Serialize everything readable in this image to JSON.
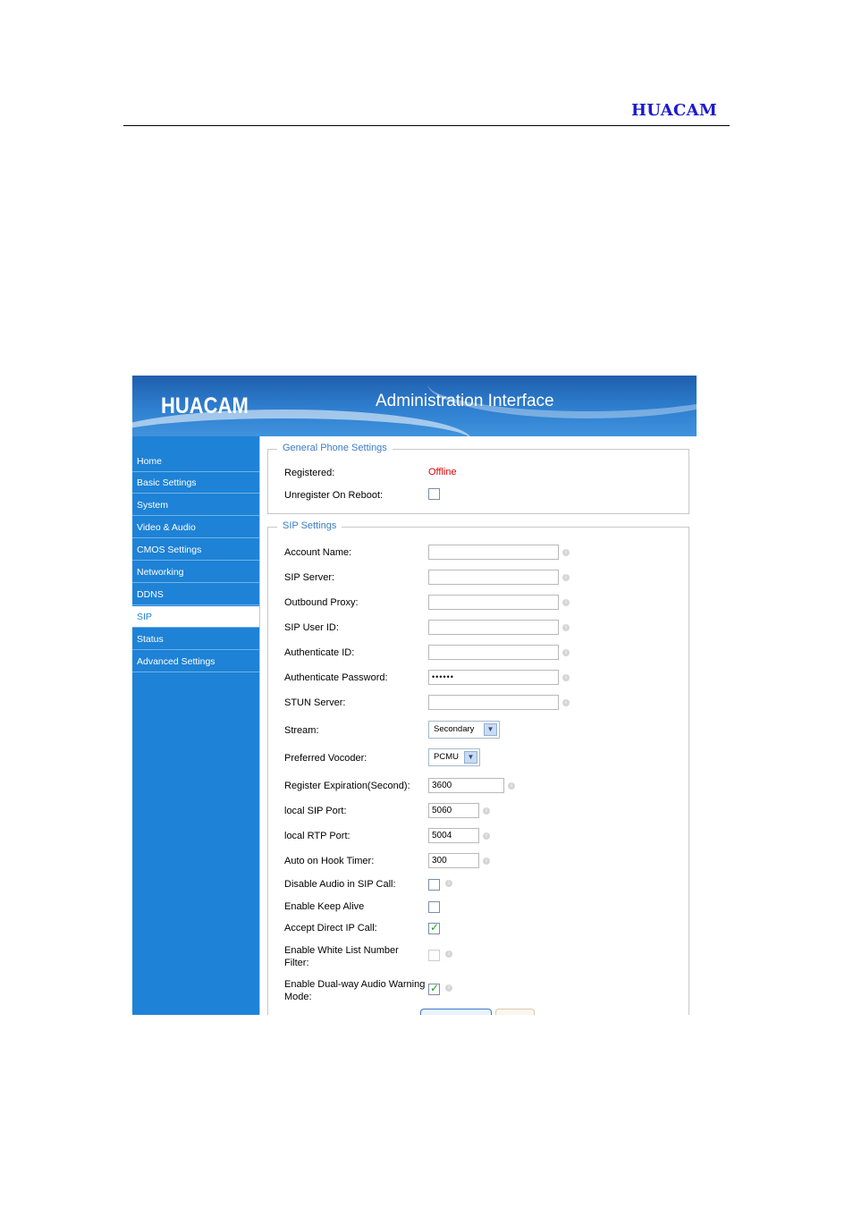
{
  "document": {
    "brand": "HUACAM"
  },
  "banner": {
    "logo": "HUACAM",
    "title": "Administration Interface"
  },
  "sidebar": {
    "items": [
      {
        "label": "Home"
      },
      {
        "label": "Basic Settings"
      },
      {
        "label": "System"
      },
      {
        "label": "Video & Audio"
      },
      {
        "label": "CMOS Settings"
      },
      {
        "label": "Networking"
      },
      {
        "label": "DDNS"
      },
      {
        "label": "SIP",
        "active": true
      },
      {
        "label": "Status"
      },
      {
        "label": "Advanced Settings"
      }
    ]
  },
  "general": {
    "legend": "General Phone Settings",
    "registered_label": "Registered:",
    "registered_value": "Offline",
    "unregister_label": "Unregister On Reboot:",
    "unregister_checked": false
  },
  "sip": {
    "legend": "SIP Settings",
    "account_name_label": "Account Name:",
    "account_name_value": "",
    "sip_server_label": "SIP Server:",
    "sip_server_value": "",
    "outbound_proxy_label": "Outbound Proxy:",
    "outbound_proxy_value": "",
    "sip_user_id_label": "SIP User ID:",
    "sip_user_id_value": "",
    "auth_id_label": "Authenticate ID:",
    "auth_id_value": "",
    "auth_password_label": "Authenticate Password:",
    "auth_password_value": "••••••",
    "stun_label": "STUN Server:",
    "stun_value": "",
    "stream_label": "Stream:",
    "stream_value": "Secondary",
    "vocoder_label": "Preferred Vocoder:",
    "vocoder_value": "PCMU",
    "reg_exp_label": "Register Expiration(Second):",
    "reg_exp_value": "3600",
    "local_sip_port_label": "local SIP Port:",
    "local_sip_port_value": "5060",
    "local_rtp_port_label": "local RTP Port:",
    "local_rtp_port_value": "5004",
    "auto_hook_label": "Auto on Hook Timer:",
    "auto_hook_value": "300",
    "disable_audio_label": "Disable Audio in SIP Call:",
    "disable_audio_checked": false,
    "keep_alive_label": "Enable Keep Alive",
    "keep_alive_checked": false,
    "direct_ip_label": "Accept Direct IP Call:",
    "direct_ip_checked": true,
    "white_list_label_1": "Enable White List Number",
    "white_list_label_2": "Filter:",
    "white_list_checked": false,
    "dual_way_label_1": "Enable Dual-way Audio Warning",
    "dual_way_label_2": "Mode:",
    "dual_way_checked": true
  },
  "icons": {
    "info": "info-icon",
    "dropdown": "chevron-down-icon",
    "check": "checkmark-icon"
  },
  "colors": {
    "brand_text": "#1a1ad0",
    "sidebar": "#1e82d6",
    "legend": "#3b7cc4",
    "offline": "#e00000"
  }
}
